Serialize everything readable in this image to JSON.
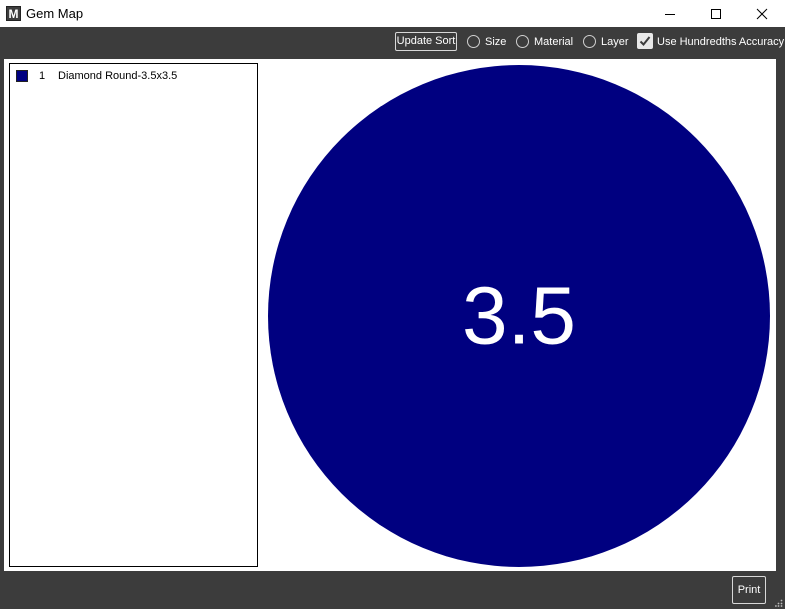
{
  "window": {
    "title": "Gem Map",
    "icon_letter": "M"
  },
  "toolbar": {
    "update_sort_label": "Update Sort",
    "sort_options": [
      "Size",
      "Material",
      "Layer"
    ],
    "accuracy_label": "Use Hundredths Accuracy",
    "accuracy_checked": true
  },
  "legend": {
    "items": [
      {
        "number": "1",
        "label": "Diamond Round-3.5x3.5",
        "color": "#000080"
      }
    ]
  },
  "gem": {
    "label": "3.5",
    "color": "#000080"
  },
  "footer": {
    "print_label": "Print"
  }
}
